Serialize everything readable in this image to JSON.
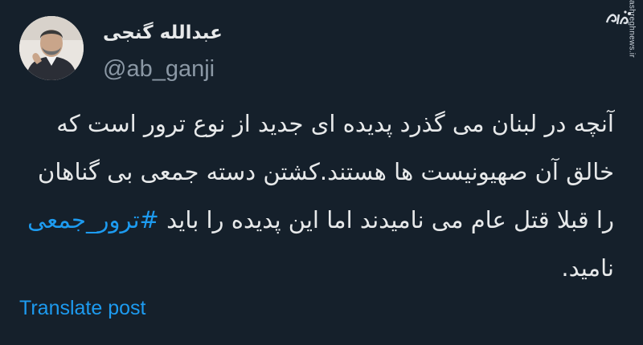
{
  "author": {
    "display_name": "عبدالله گنجی",
    "handle": "@ab_ganji",
    "avatar_icon": "profile-photo"
  },
  "tweet": {
    "text_before": "آنچه در لبنان می گذرد پدیده ای جدید از نوع ترور است که خالق آن صهیونیست ها هستند.کشتن دسته جمعی بی گناهان را قبلا قتل عام می نامیدند اما این پدیده را باید ",
    "hashtag": "#ترور_جمعی",
    "text_after": " نامید."
  },
  "actions": {
    "translate_label": "Translate post"
  },
  "watermark": {
    "logo_text": "مشرق",
    "site": "mashreghnews.ir"
  },
  "colors": {
    "background": "#15202b",
    "text": "#e7e9ea",
    "muted": "#8b98a5",
    "link": "#1d9bf0"
  }
}
